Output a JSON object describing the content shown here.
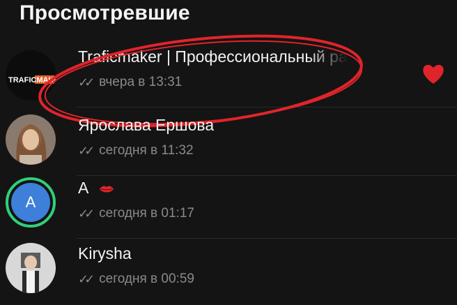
{
  "header": {
    "title": "Просмотревшие"
  },
  "viewers": [
    {
      "name": "Traficmaker | Профессиональный ра",
      "time": "вчера в 13:31",
      "avatar_text": "TRAFICMAKER"
    },
    {
      "name": "Ярослава Ершова",
      "time": "сегодня в 11:32"
    },
    {
      "name": "А",
      "time": "сегодня в 01:17",
      "avatar_letter": "A"
    },
    {
      "name": "Kirysha",
      "time": "сегодня в 00:59"
    }
  ],
  "colors": {
    "accent_red": "#e0242b",
    "ring_green": "#2fd07a",
    "ring_blue": "#2b7fe0",
    "avatar_blue": "#3d7fd9"
  },
  "icons": [
    "double-check-icon",
    "heart-icon",
    "lips-emoji-icon"
  ]
}
